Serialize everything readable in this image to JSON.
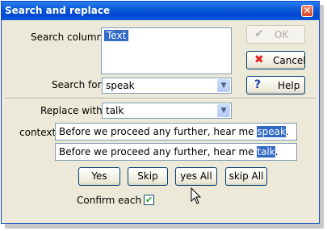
{
  "window": {
    "title": "Search and replace",
    "close_glyph": "✕"
  },
  "search_column": {
    "label": "Search column",
    "items": [
      "Text"
    ],
    "selected": "Text"
  },
  "search_for": {
    "label": "Search for",
    "value": "speak"
  },
  "replace_with": {
    "label": "Replace with",
    "value": "talk"
  },
  "buttons": {
    "ok": {
      "label": "OK",
      "icon": "check-icon",
      "enabled": false
    },
    "cancel": {
      "label": "Cancel",
      "icon": "x-icon"
    },
    "help": {
      "label": "Help",
      "icon": "question-icon"
    }
  },
  "context": {
    "label": "context",
    "before_prefix": "Before we proceed any further, hear me ",
    "before_match": "speak",
    "before_suffix": ".",
    "after_prefix": "Before we proceed any further, hear me ",
    "after_match": "talk",
    "after_suffix": "."
  },
  "actions": {
    "yes": "Yes",
    "skip": "Skip",
    "yes_all": "yes All",
    "skip_all": "skip All"
  },
  "confirm_each": {
    "label": "Confirm each",
    "checked": true,
    "check_glyph": "✔"
  },
  "colors": {
    "title_bar": "#0a5ad8",
    "selection": "#316ac5",
    "dialog_bg": "#ece9d8"
  }
}
